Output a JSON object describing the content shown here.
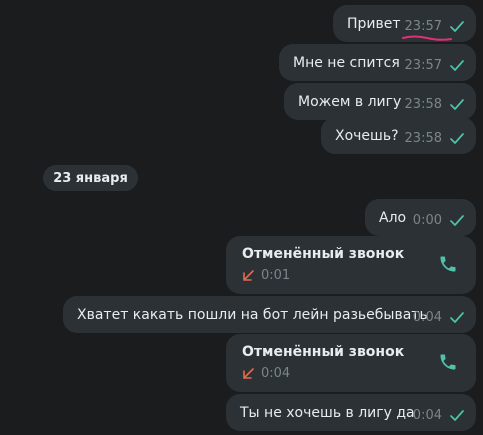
{
  "colors": {
    "background": "#1a1c1e",
    "bubble": "#2b3135",
    "accent": "#4fc3a9",
    "missed_arrow": "#e06b4f",
    "annotation": "#e0307a"
  },
  "messages": [
    {
      "text": "Привет",
      "time": "23:57"
    },
    {
      "text": "Мне не спится",
      "time": "23:57"
    },
    {
      "text": "Можем в лигу",
      "time": "23:58"
    },
    {
      "text": "Хочешь?",
      "time": "23:58"
    },
    {
      "text": "Ало",
      "time": "0:00"
    },
    {
      "text": "Хватет какать пошли на бот лейн разьебывать",
      "time": "0:04"
    },
    {
      "text": "Ты не хочешь в лигу да",
      "time": "0:04"
    }
  ],
  "date_separator": "23 января",
  "calls": [
    {
      "title": "Отменённый звонок",
      "duration": "0:01",
      "icon": "phone-icon"
    },
    {
      "title": "Отменённый звонок",
      "duration": "0:04",
      "icon": "phone-icon"
    }
  ]
}
